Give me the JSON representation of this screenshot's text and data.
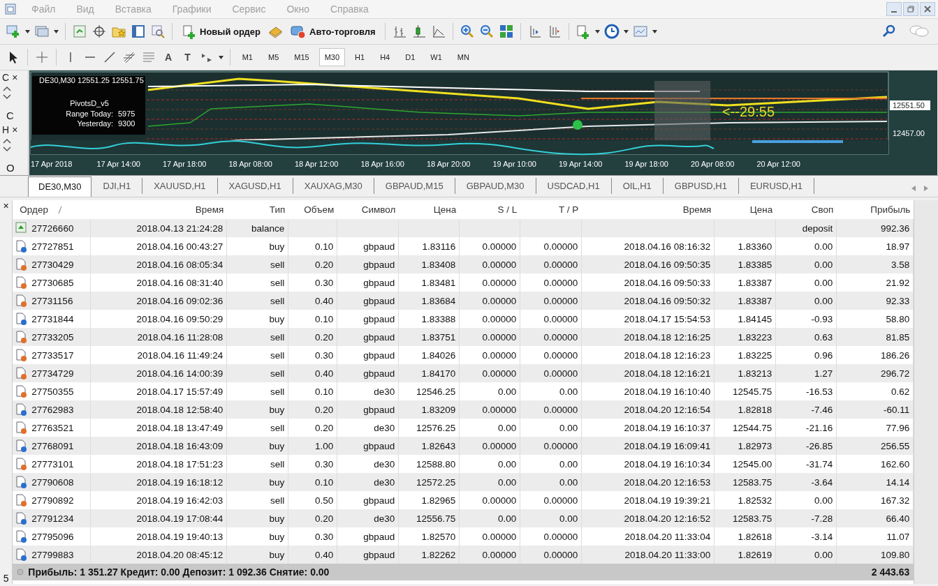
{
  "menu": [
    "Файл",
    "Вид",
    "Вставка",
    "Графики",
    "Сервис",
    "Окно",
    "Справка"
  ],
  "toolbar": {
    "new_order": "Новый ордер",
    "auto_trading": "Авто-торговля"
  },
  "draw_tools": [
    {
      "kind": "cursor"
    },
    {
      "kind": "crosshair"
    },
    {
      "kind": "vline"
    },
    {
      "kind": "hline"
    },
    {
      "kind": "trend"
    },
    {
      "kind": "fibo"
    },
    {
      "kind": "channel"
    },
    {
      "kind": "text",
      "label": "A"
    },
    {
      "kind": "label",
      "label": "T"
    },
    {
      "kind": "arrows"
    }
  ],
  "timeframes": [
    {
      "label": "M1",
      "selected": false
    },
    {
      "label": "M5",
      "selected": false
    },
    {
      "label": "M15",
      "selected": false
    },
    {
      "label": "M30",
      "selected": true
    },
    {
      "label": "H1",
      "selected": false
    },
    {
      "label": "H4",
      "selected": false
    },
    {
      "label": "D1",
      "selected": false
    },
    {
      "label": "W1",
      "selected": false
    },
    {
      "label": "MN",
      "selected": false
    }
  ],
  "side_panels": [
    {
      "title": "C",
      "close": "×",
      "letter": "C"
    },
    {
      "title": "H",
      "close": "×",
      "letter": "O"
    }
  ],
  "chart": {
    "header": "DE30,M30  12551.25  12551.75",
    "indicator_title": "PivotsD_v5",
    "indicator_rows": [
      {
        "label": "Range  Today:",
        "value": "5975"
      },
      {
        "label": "Yesterday:",
        "value": "9300"
      }
    ],
    "countdown": "<--29:55",
    "price_labels": [
      "12551.50",
      "12457.00"
    ],
    "time_labels": [
      "17 Apr 2018",
      "17 Apr 14:00",
      "17 Apr 18:00",
      "18 Apr 08:00",
      "18 Apr 12:00",
      "18 Apr 16:00",
      "18 Apr 20:00",
      "19 Apr 10:00",
      "19 Apr 14:00",
      "19 Apr 18:00",
      "20 Apr 08:00",
      "20 Apr 12:00"
    ]
  },
  "chart_tabs": [
    {
      "label": "DE30,M30",
      "selected": true
    },
    {
      "label": "DJI,H1",
      "selected": false
    },
    {
      "label": "XAUUSD,H1",
      "selected": false
    },
    {
      "label": "XAGUSD,H1",
      "selected": false
    },
    {
      "label": "XAUXAG,M30",
      "selected": false
    },
    {
      "label": "GBPAUD,M15",
      "selected": false
    },
    {
      "label": "GBPAUD,M30",
      "selected": false
    },
    {
      "label": "USDCAD,H1",
      "selected": false
    },
    {
      "label": "OIL,H1",
      "selected": false
    },
    {
      "label": "GBPUSD,H1",
      "selected": false
    },
    {
      "label": "EURUSD,H1",
      "selected": false
    }
  ],
  "terminal": {
    "close": "×",
    "tab_number": "5"
  },
  "table": {
    "columns": [
      {
        "label": "Ордер",
        "sorted": true
      },
      {
        "label": "Время",
        "sorted": false
      },
      {
        "label": "Тип",
        "sorted": false
      },
      {
        "label": "Объем",
        "sorted": false
      },
      {
        "label": "Символ",
        "sorted": false
      },
      {
        "label": "Цена",
        "sorted": false
      },
      {
        "label": "S / L",
        "sorted": false
      },
      {
        "label": "T / P",
        "sorted": false
      },
      {
        "label": "Время",
        "sorted": false
      },
      {
        "label": "Цена",
        "sorted": false
      },
      {
        "label": "Своп",
        "sorted": false
      },
      {
        "label": "Прибыль",
        "sorted": false
      }
    ],
    "rows": [
      {
        "kind": "balance",
        "order": "27726660",
        "open_time": "2018.04.13 21:24:28",
        "type": "balance",
        "swap": "deposit",
        "profit": "992.36"
      },
      {
        "kind": "buy",
        "order": "27727851",
        "open_time": "2018.04.16 00:43:27",
        "type": "buy",
        "volume": "0.10",
        "symbol": "gbpaud",
        "open_price": "1.83116",
        "sl": "0.00000",
        "tp": "0.00000",
        "close_time": "2018.04.16 08:16:32",
        "close_price": "1.83360",
        "swap": "0.00",
        "profit": "18.97"
      },
      {
        "kind": "sell",
        "order": "27730429",
        "open_time": "2018.04.16 08:05:34",
        "type": "sell",
        "volume": "0.20",
        "symbol": "gbpaud",
        "open_price": "1.83408",
        "sl": "0.00000",
        "tp": "0.00000",
        "close_time": "2018.04.16 09:50:35",
        "close_price": "1.83385",
        "swap": "0.00",
        "profit": "3.58"
      },
      {
        "kind": "sell",
        "order": "27730685",
        "open_time": "2018.04.16 08:31:40",
        "type": "sell",
        "volume": "0.30",
        "symbol": "gbpaud",
        "open_price": "1.83481",
        "sl": "0.00000",
        "tp": "0.00000",
        "close_time": "2018.04.16 09:50:33",
        "close_price": "1.83387",
        "swap": "0.00",
        "profit": "21.92"
      },
      {
        "kind": "sell",
        "order": "27731156",
        "open_time": "2018.04.16 09:02:36",
        "type": "sell",
        "volume": "0.40",
        "symbol": "gbpaud",
        "open_price": "1.83684",
        "sl": "0.00000",
        "tp": "0.00000",
        "close_time": "2018.04.16 09:50:32",
        "close_price": "1.83387",
        "swap": "0.00",
        "profit": "92.33"
      },
      {
        "kind": "buy",
        "order": "27731844",
        "open_time": "2018.04.16 09:50:29",
        "type": "buy",
        "volume": "0.10",
        "symbol": "gbpaud",
        "open_price": "1.83388",
        "sl": "0.00000",
        "tp": "0.00000",
        "close_time": "2018.04.17 15:54:53",
        "close_price": "1.84145",
        "swap": "-0.93",
        "profit": "58.80"
      },
      {
        "kind": "sell",
        "order": "27733205",
        "open_time": "2018.04.16 11:28:08",
        "type": "sell",
        "volume": "0.20",
        "symbol": "gbpaud",
        "open_price": "1.83751",
        "sl": "0.00000",
        "tp": "0.00000",
        "close_time": "2018.04.18 12:16:25",
        "close_price": "1.83223",
        "swap": "0.63",
        "profit": "81.85"
      },
      {
        "kind": "sell",
        "order": "27733517",
        "open_time": "2018.04.16 11:49:24",
        "type": "sell",
        "volume": "0.30",
        "symbol": "gbpaud",
        "open_price": "1.84026",
        "sl": "0.00000",
        "tp": "0.00000",
        "close_time": "2018.04.18 12:16:23",
        "close_price": "1.83225",
        "swap": "0.96",
        "profit": "186.26"
      },
      {
        "kind": "sell",
        "order": "27734729",
        "open_time": "2018.04.16 14:00:39",
        "type": "sell",
        "volume": "0.40",
        "symbol": "gbpaud",
        "open_price": "1.84170",
        "sl": "0.00000",
        "tp": "0.00000",
        "close_time": "2018.04.18 12:16:21",
        "close_price": "1.83213",
        "swap": "1.27",
        "profit": "296.72"
      },
      {
        "kind": "sell",
        "order": "27750355",
        "open_time": "2018.04.17 15:57:49",
        "type": "sell",
        "volume": "0.10",
        "symbol": "de30",
        "open_price": "12546.25",
        "sl": "0.00",
        "tp": "0.00",
        "close_time": "2018.04.19 16:10:40",
        "close_price": "12545.75",
        "swap": "-16.53",
        "profit": "0.62"
      },
      {
        "kind": "buy",
        "order": "27762983",
        "open_time": "2018.04.18 12:58:40",
        "type": "buy",
        "volume": "0.20",
        "symbol": "gbpaud",
        "open_price": "1.83209",
        "sl": "0.00000",
        "tp": "0.00000",
        "close_time": "2018.04.20 12:16:54",
        "close_price": "1.82818",
        "swap": "-7.46",
        "profit": "-60.11"
      },
      {
        "kind": "sell",
        "order": "27763521",
        "open_time": "2018.04.18 13:47:49",
        "type": "sell",
        "volume": "0.20",
        "symbol": "de30",
        "open_price": "12576.25",
        "sl": "0.00",
        "tp": "0.00",
        "close_time": "2018.04.19 16:10:37",
        "close_price": "12544.75",
        "swap": "-21.16",
        "profit": "77.96"
      },
      {
        "kind": "buy",
        "order": "27768091",
        "open_time": "2018.04.18 16:43:09",
        "type": "buy",
        "volume": "1.00",
        "symbol": "gbpaud",
        "open_price": "1.82643",
        "sl": "0.00000",
        "tp": "0.00000",
        "close_time": "2018.04.19 16:09:41",
        "close_price": "1.82973",
        "swap": "-26.85",
        "profit": "256.55"
      },
      {
        "kind": "sell",
        "order": "27773101",
        "open_time": "2018.04.18 17:51:23",
        "type": "sell",
        "volume": "0.30",
        "symbol": "de30",
        "open_price": "12588.80",
        "sl": "0.00",
        "tp": "0.00",
        "close_time": "2018.04.19 16:10:34",
        "close_price": "12545.00",
        "swap": "-31.74",
        "profit": "162.60"
      },
      {
        "kind": "buy",
        "order": "27790608",
        "open_time": "2018.04.19 16:18:12",
        "type": "buy",
        "volume": "0.10",
        "symbol": "de30",
        "open_price": "12572.25",
        "sl": "0.00",
        "tp": "0.00",
        "close_time": "2018.04.20 12:16:53",
        "close_price": "12583.75",
        "swap": "-3.64",
        "profit": "14.14"
      },
      {
        "kind": "sell",
        "order": "27790892",
        "open_time": "2018.04.19 16:42:03",
        "type": "sell",
        "volume": "0.50",
        "symbol": "gbpaud",
        "open_price": "1.82965",
        "sl": "0.00000",
        "tp": "0.00000",
        "close_time": "2018.04.19 19:39:21",
        "close_price": "1.82532",
        "swap": "0.00",
        "profit": "167.32"
      },
      {
        "kind": "buy",
        "order": "27791234",
        "open_time": "2018.04.19 17:08:44",
        "type": "buy",
        "volume": "0.20",
        "symbol": "de30",
        "open_price": "12556.75",
        "sl": "0.00",
        "tp": "0.00",
        "close_time": "2018.04.20 12:16:52",
        "close_price": "12583.75",
        "swap": "-7.28",
        "profit": "66.40"
      },
      {
        "kind": "buy",
        "order": "27795096",
        "open_time": "2018.04.19 19:40:13",
        "type": "buy",
        "volume": "0.30",
        "symbol": "gbpaud",
        "open_price": "1.82570",
        "sl": "0.00000",
        "tp": "0.00000",
        "close_time": "2018.04.20 11:33:04",
        "close_price": "1.82618",
        "swap": "-3.14",
        "profit": "11.07"
      },
      {
        "kind": "buy",
        "order": "27799883",
        "open_time": "2018.04.20 08:45:12",
        "type": "buy",
        "volume": "0.40",
        "symbol": "gbpaud",
        "open_price": "1.82262",
        "sl": "0.00000",
        "tp": "0.00000",
        "close_time": "2018.04.20 11:33:00",
        "close_price": "1.82619",
        "swap": "0.00",
        "profit": "109.80"
      }
    ],
    "summary": "Прибыль: 1 351.27  Кредит: 0.00  Депозит: 1 092.36  Снятие: 0.00",
    "total": "2 443.63"
  }
}
